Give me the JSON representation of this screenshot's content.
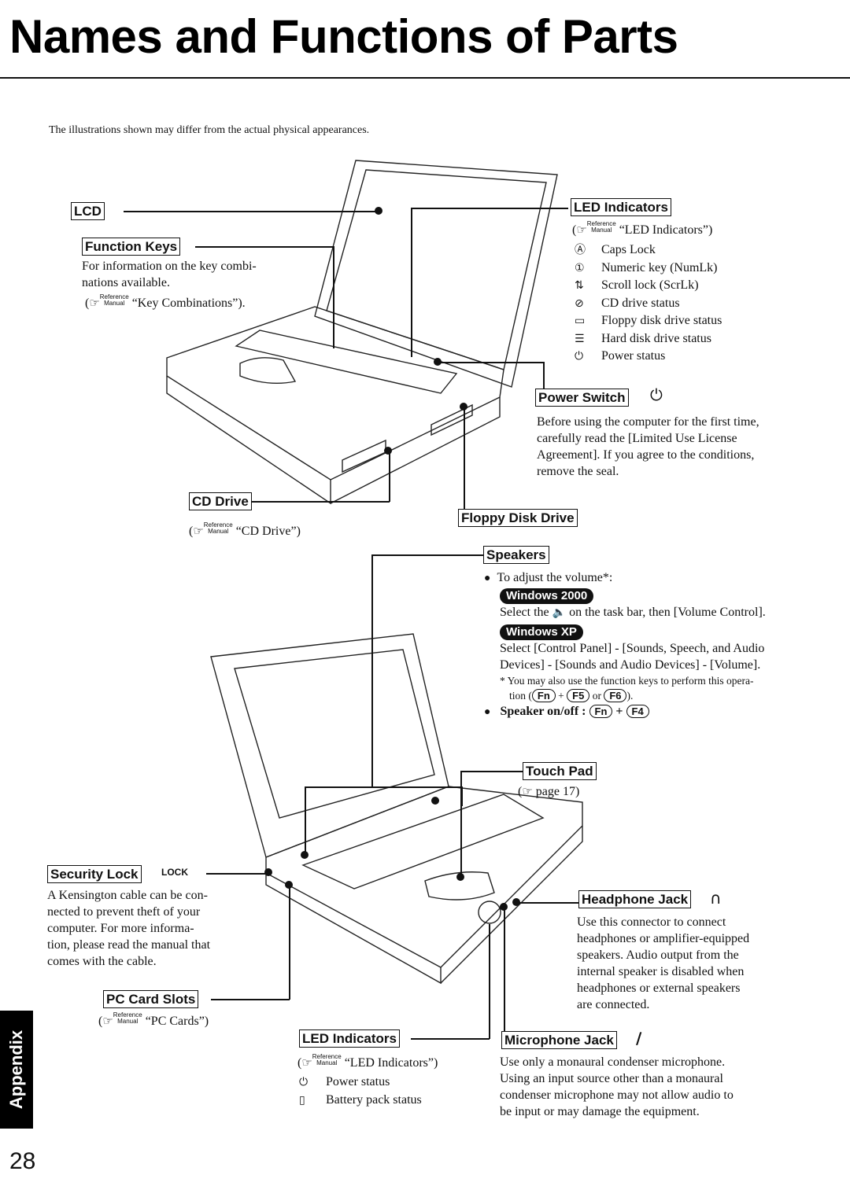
{
  "page": {
    "title": "Names and Functions of Parts",
    "note": "The illustrations shown may differ from the actual physical appearances.",
    "section_tab": "Appendix",
    "page_number": "28"
  },
  "reference": {
    "mark_top": "Reference",
    "mark_bottom": "Manual",
    "hand_icon": "pointing-hand-icon"
  },
  "top_illustration": {
    "lcd": {
      "label": "LCD"
    },
    "function_keys": {
      "label": "Function Keys",
      "description": "For information on the key combinations available.",
      "desc_line1": "For information on the key combi-",
      "desc_line2": "nations available.",
      "reference": "“Key Combinations”)."
    },
    "led_indicators": {
      "label": "LED Indicators",
      "reference": "“LED Indicators”)",
      "items": [
        {
          "icon": "caps-lock-icon",
          "glyph": "Ⓐ",
          "label": "Caps Lock"
        },
        {
          "icon": "numlock-icon",
          "glyph": "①",
          "label": "Numeric key (NumLk)"
        },
        {
          "icon": "scroll-lock-icon",
          "glyph": "⇅",
          "label": "Scroll lock (ScrLk)"
        },
        {
          "icon": "cd-drive-icon",
          "glyph": "⊘",
          "label": "CD drive status"
        },
        {
          "icon": "floppy-icon",
          "glyph": "▭",
          "label": "Floppy disk drive status"
        },
        {
          "icon": "hard-disk-icon",
          "glyph": "☰",
          "label": "Hard disk drive status"
        },
        {
          "icon": "power-status-icon",
          "glyph": "⏻",
          "label": "Power status"
        }
      ]
    },
    "power_switch": {
      "label": "Power Switch",
      "icon": "power-icon",
      "glyph": "⏻",
      "desc_lines": [
        "Before using the computer for the first time,",
        "carefully read the [Limited Use License",
        "Agreement]. If you agree to the conditions,",
        "remove the seal."
      ]
    },
    "cd_drive": {
      "label": "CD Drive",
      "reference": "“CD Drive”)"
    },
    "floppy_disk_drive": {
      "label": "Floppy Disk Drive"
    }
  },
  "bottom_illustration": {
    "speakers": {
      "label": "Speakers",
      "adjust": "To adjust the volume*:",
      "win2000_badge": "Windows 2000",
      "win2000_text_pre": "Select the",
      "win2000_text_post": "on the task bar, then [Volume Control].",
      "winxp_badge": "Windows XP",
      "winxp_line1": "Select [Control Panel] - [Sounds, Speech, and Audio",
      "winxp_line2": "Devices] - [Sounds and Audio Devices] - [Volume].",
      "footnote_line1": "* You may also use the function keys to perform this opera-",
      "footnote_pre": "tion (",
      "footnote_key1": "Fn",
      "footnote_plus": "+",
      "footnote_key2": "F5",
      "footnote_or": "or",
      "footnote_key3": "F6",
      "footnote_post": ").",
      "onoff_label": "Speaker on/off :",
      "onoff_key1": "Fn",
      "onoff_plus": "+",
      "onoff_key2": "F4"
    },
    "touch_pad": {
      "label": "Touch Pad",
      "reference": "page 17)"
    },
    "security_lock": {
      "label": "Security Lock",
      "marking": "LOCK",
      "desc_lines": [
        "A Kensington cable can be con-",
        "nected to prevent theft of your",
        "computer.  For more informa-",
        "tion, please read the manual that",
        "comes with the cable."
      ]
    },
    "pc_card_slots": {
      "label": "PC Card Slots",
      "reference": "“PC Cards”)"
    },
    "headphone_jack": {
      "label": "Headphone Jack",
      "icon": "headphone-icon",
      "glyph": "∩",
      "desc_lines": [
        "Use this connector to connect",
        "headphones or amplifier-equipped",
        "speakers.  Audio output from the",
        "internal speaker is disabled when",
        "headphones or external speakers",
        "are connected."
      ]
    },
    "led_indicators": {
      "label": "LED Indicators",
      "reference": "“LED Indicators”)",
      "items": [
        {
          "icon": "power-status-icon",
          "glyph": "⏻",
          "label": "Power status"
        },
        {
          "icon": "battery-icon",
          "glyph": "▯",
          "label": "Battery pack status"
        }
      ]
    },
    "microphone_jack": {
      "label": "Microphone Jack",
      "icon": "microphone-icon",
      "glyph": "∕",
      "desc_lines": [
        "Use only a monaural condenser microphone.",
        "Using an input source other than a monaural",
        "condenser microphone may not allow audio to",
        "be input or may damage the equipment."
      ]
    }
  }
}
